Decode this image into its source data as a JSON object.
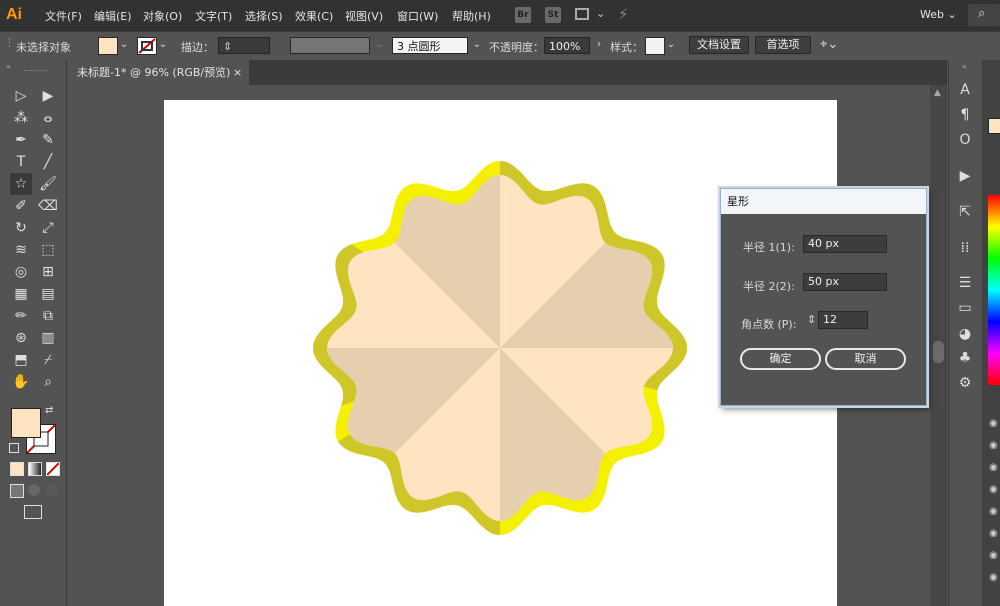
{
  "app": {
    "logo": "Ai",
    "workspace": "Web ⌄"
  },
  "menu": [
    "文件(F)",
    "编辑(E)",
    "对象(O)",
    "文字(T)",
    "选择(S)",
    "效果(C)",
    "视图(V)",
    "窗口(W)",
    "帮助(H)"
  ],
  "menu_icons": {
    "br": "Br",
    "st": "St"
  },
  "control": {
    "selection": "未选择对象",
    "stroke_label": "描边：",
    "brush": "3 点圆形",
    "opacity_label": "不透明度：",
    "opacity_value": "100%",
    "style_label": "样式：",
    "doc_settings": "文档设置",
    "preferences": "首选项"
  },
  "document": {
    "tab_title": "未标题-1* @ 96% (RGB/预览)",
    "close": "×"
  },
  "colors": {
    "fill": "#ffe4c1",
    "stroke_outer": "#f5f000",
    "stroke_dark": "#cfc62a",
    "ui_dark": "#323232"
  },
  "dialog": {
    "title": "星形",
    "radius1_label": "半径 1(1):",
    "radius1_value": "40 px",
    "radius2_label": "半径 2(2):",
    "radius2_value": "50 px",
    "points_label": "角点数 (P):",
    "points_value": "12",
    "ok": "确定",
    "cancel": "取消"
  },
  "tools": [
    "selection-tool",
    "direct-selection-tool",
    "magic-wand-tool",
    "lasso-tool",
    "pen-tool",
    "curvature-tool",
    "type-tool",
    "line-tool",
    "star-tool",
    "paintbrush-tool",
    "shaper-tool",
    "eraser-tool",
    "rotate-tool",
    "scale-tool",
    "warp-tool",
    "free-transform-tool",
    "shape-builder-tool",
    "perspective-grid-tool",
    "mesh-tool",
    "gradient-tool",
    "eyedropper-tool",
    "blend-tool",
    "symbol-sprayer-tool",
    "column-graph-tool",
    "artboard-tool",
    "slice-tool",
    "hand-tool",
    "zoom-tool"
  ],
  "right_panel_icons": [
    "character-icon",
    "paragraph-icon",
    "opentype-icon",
    "play-icon",
    "export-icon",
    "grid-icon",
    "align-icon",
    "transparency-icon",
    "appearance-icon",
    "symbols-icon",
    "gear-icon"
  ]
}
